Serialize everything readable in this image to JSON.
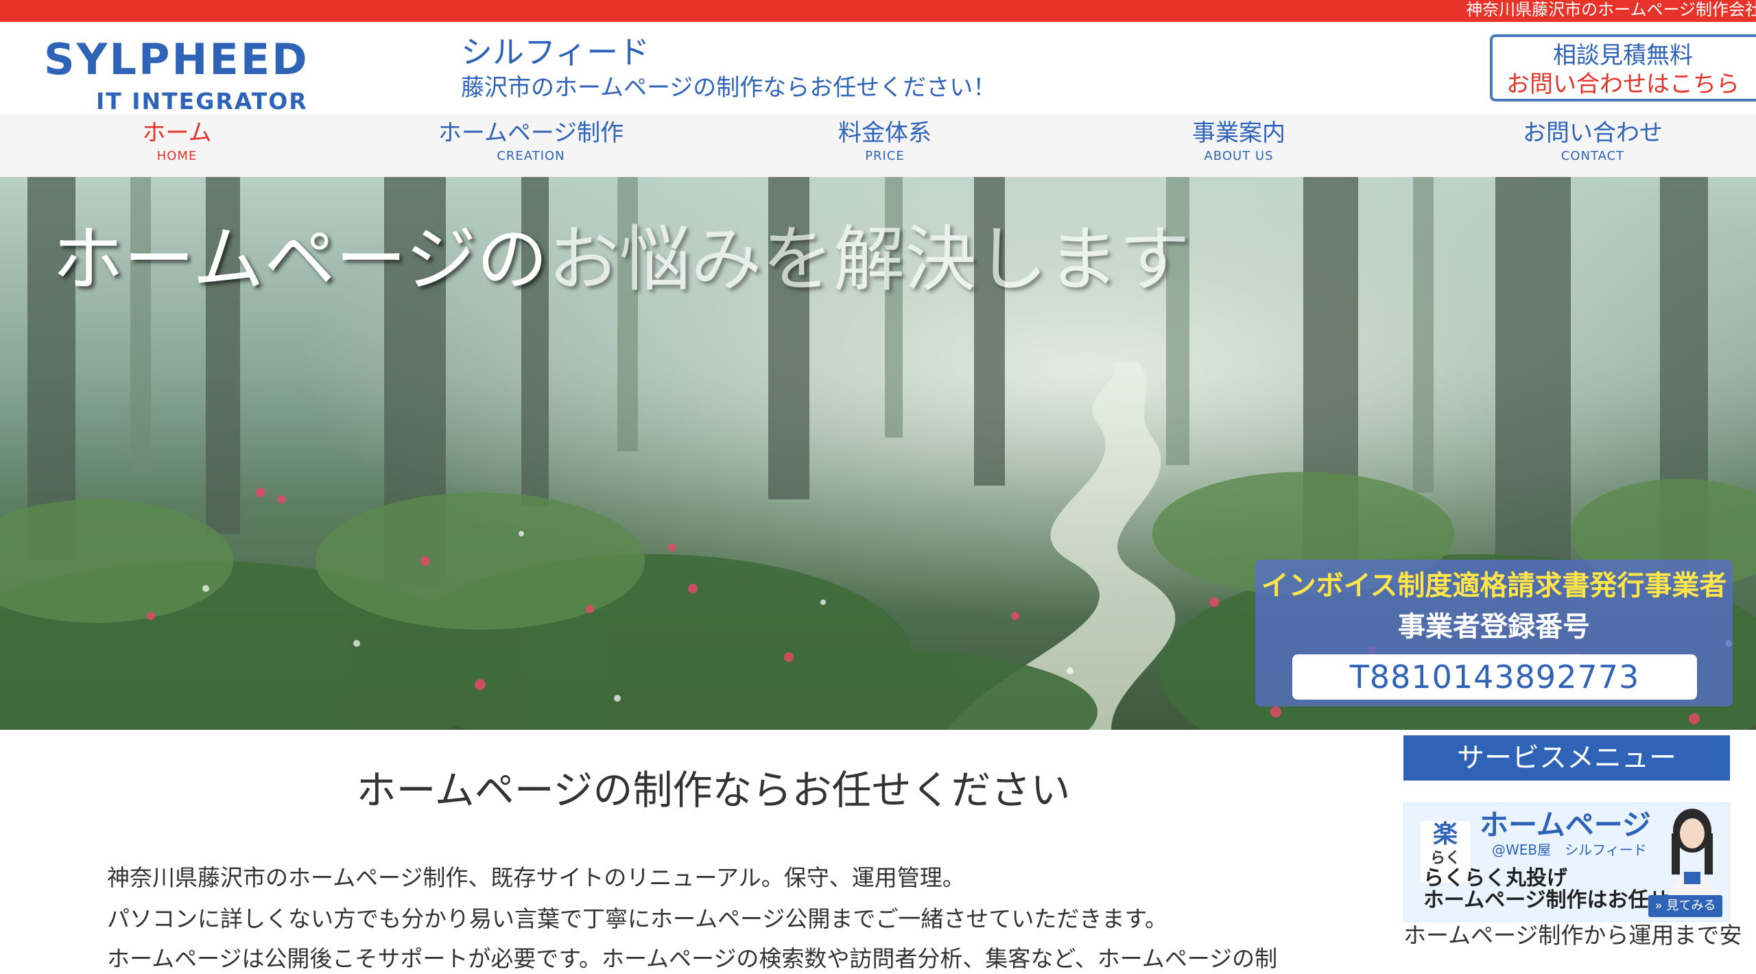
{
  "topbar": {
    "text": "神奈川県藤沢市のホームページ制作会社"
  },
  "header": {
    "logo_main": "SYLPHEED",
    "logo_sub": "IT INTEGRATOR",
    "site_name": "シルフィード",
    "tagline": "藤沢市のホームページの制作ならお任せください！",
    "cta_line1": "相談見積無料",
    "cta_line2": "お問い合わせはこちら"
  },
  "nav": {
    "items": [
      {
        "jp": "ホーム",
        "en": "HOME"
      },
      {
        "jp": "ホームページ制作",
        "en": "CREATION"
      },
      {
        "jp": "料金体系",
        "en": "PRICE"
      },
      {
        "jp": "事業案内",
        "en": "ABOUT US"
      },
      {
        "jp": "お問い合わせ",
        "en": "CONTACT"
      }
    ]
  },
  "hero": {
    "title_a": "ホームページの",
    "title_b": "お悩みを解決します",
    "invoice_line1": "インボイス制度適格請求書発行事業者",
    "invoice_line2": "事業者登録番号",
    "invoice_number": "T8810143892773"
  },
  "main": {
    "heading": "ホームページの制作ならお任せください",
    "paragraphs": [
      "神奈川県藤沢市のホームページ制作、既存サイトのリニューアル。保守、運用管理。",
      "パソコンに詳しくない方でも分かり易い言葉で丁寧にホームページ公開までご一緒させていただきます。",
      "ホームページは公開後こそサポートが必要です。ホームページの検索数や訪問者分析、集客など、ホームページの制"
    ]
  },
  "sidebar": {
    "heading": "サービスメニュー",
    "banner": {
      "raku": "楽",
      "raku_small": "らく",
      "hp": "ホームページ",
      "web": "@WEB屋　シルフィード",
      "line1": "らくらく丸投げ",
      "line2": "ホームページ制作はお任せ",
      "button": "見てみる"
    },
    "text": "ホームページ制作から運用まで安"
  },
  "colors": {
    "brand_blue": "#2f63b8",
    "accent_red": "#e8332a",
    "invoice_yellow": "#ffe44a"
  }
}
